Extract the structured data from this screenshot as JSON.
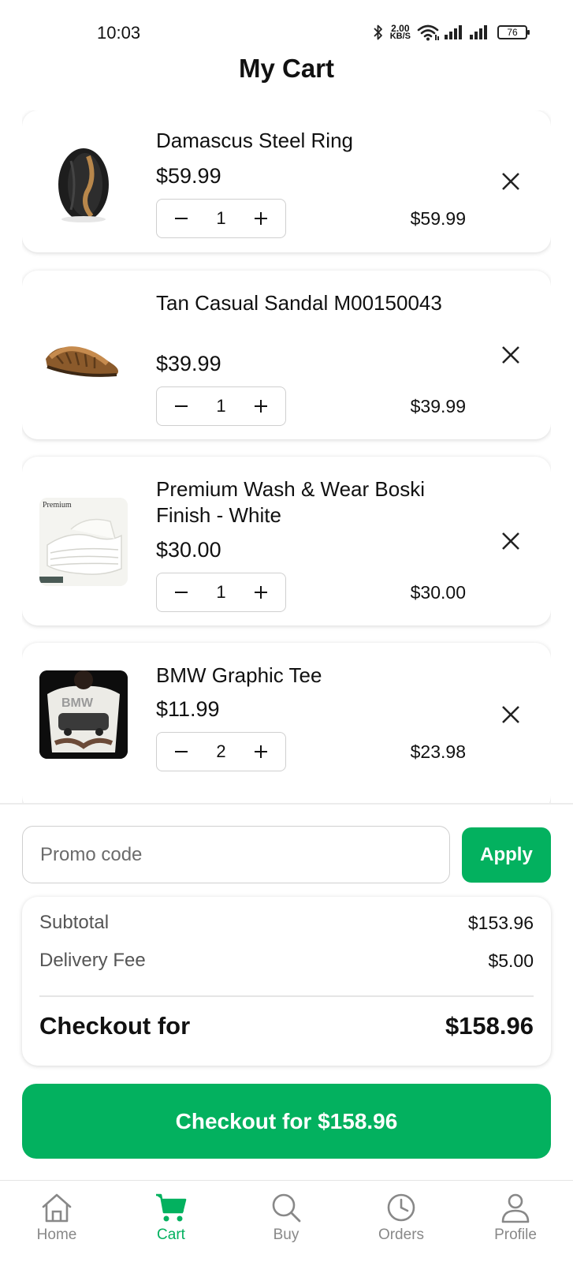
{
  "status_bar": {
    "time": "10:03",
    "net_speed_value": "2.00",
    "net_speed_unit": "KB/S",
    "battery": "76",
    "icons": [
      "bluetooth-icon",
      "wifi-icon",
      "signal-icon",
      "signal-icon",
      "battery-icon"
    ]
  },
  "header": {
    "title": "My Cart"
  },
  "cart": {
    "items": [
      {
        "name": "Damascus Steel Ring",
        "price": "$59.99",
        "quantity": "1",
        "line_total": "$59.99",
        "image": "ring-image"
      },
      {
        "name": "Tan Casual Sandal M00150043",
        "price": "$39.99",
        "quantity": "1",
        "line_total": "$39.99",
        "image": "sandal-image"
      },
      {
        "name": "Premium Wash & Wear Boski Finish - White",
        "price": "$30.00",
        "quantity": "1",
        "line_total": "$30.00",
        "image": "fabric-image",
        "image_text": "Premium"
      },
      {
        "name": "BMW Graphic Tee",
        "price": "$11.99",
        "quantity": "2",
        "line_total": "$23.98",
        "image": "tee-image"
      }
    ]
  },
  "promo": {
    "placeholder": "Promo code",
    "value": "",
    "apply_label": "Apply"
  },
  "summary": {
    "subtotal_label": "Subtotal",
    "subtotal_value": "$153.96",
    "delivery_label": "Delivery Fee",
    "delivery_value": "$5.00",
    "total_label": "Checkout for",
    "total_value": "$158.96"
  },
  "checkout_button": {
    "label": "Checkout for $158.96"
  },
  "colors": {
    "accent": "#03b15f",
    "inactive": "#888888"
  },
  "nav": {
    "items": [
      {
        "label": "Home",
        "icon": "home-icon",
        "active": false
      },
      {
        "label": "Cart",
        "icon": "cart-icon",
        "active": true
      },
      {
        "label": "Buy",
        "icon": "search-icon",
        "active": false
      },
      {
        "label": "Orders",
        "icon": "clock-icon",
        "active": false
      },
      {
        "label": "Profile",
        "icon": "user-icon",
        "active": false
      }
    ]
  }
}
